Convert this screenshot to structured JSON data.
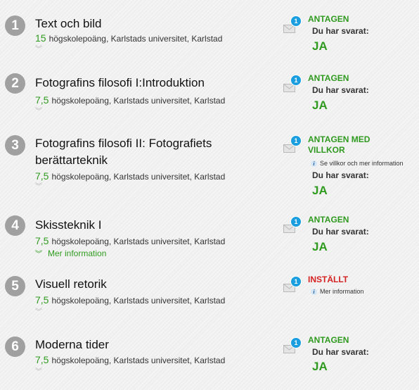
{
  "unread_count": "1",
  "courses": [
    {
      "number": "1",
      "title": "Text och bild",
      "points": "15",
      "details": "högskolepoäng, Karlstads universitet, Karlstad",
      "status": "ANTAGEN",
      "answer_label": "Du har svarat:",
      "answer": "JA"
    },
    {
      "number": "2",
      "title": "Fotografins filosofi I:Introduktion",
      "points": "7,5",
      "details": "högskolepoäng, Karlstads universitet, Karlstad",
      "status": "ANTAGEN",
      "answer_label": "Du har svarat:",
      "answer": "JA"
    },
    {
      "number": "3",
      "title": "Fotografins filosofi II: Fotografiets berättarteknik",
      "points": "7,5",
      "details": "högskolepoäng, Karlstads universitet, Karlstad",
      "status_line1": "ANTAGEN MED",
      "status_line2": "VILLKOR",
      "info_link": "Se villkor och mer information",
      "answer_label": "Du har svarat:",
      "answer": "JA"
    },
    {
      "number": "4",
      "title": "Skissteknik I",
      "points": "7,5",
      "details": "högskolepoäng, Karlstads universitet, Karlstad",
      "more_info": "Mer information",
      "status": "ANTAGEN",
      "answer_label": "Du har svarat:",
      "answer": "JA"
    },
    {
      "number": "5",
      "title": "Visuell retorik",
      "points": "7,5",
      "details": "högskolepoäng, Karlstads universitet, Karlstad",
      "status": "INSTÄLLT",
      "info_link": "Mer information"
    },
    {
      "number": "6",
      "title": "Moderna tider",
      "points": "7,5",
      "details": "högskolepoäng, Karlstads universitet, Karlstad",
      "status": "ANTAGEN",
      "answer_label": "Du har svarat:",
      "answer": "JA"
    }
  ],
  "colors": {
    "accepted": "#2f9a1f",
    "cancelled": "#d42020",
    "badge": "#1a9ee0",
    "number_circle": "#a0a0a0"
  },
  "icons": {
    "expand": "chevron-double-down-icon",
    "message": "envelope-icon",
    "info": "info-icon"
  }
}
